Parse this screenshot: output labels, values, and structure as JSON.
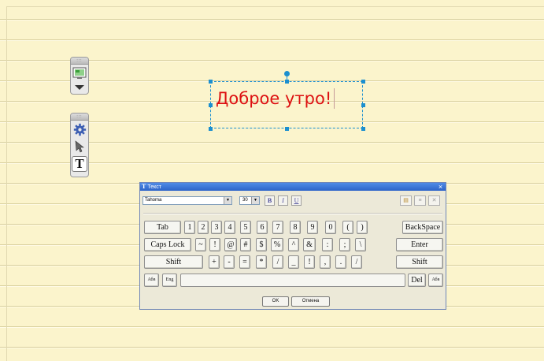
{
  "canvas": {
    "text": "Доброе утро!",
    "text_color": "#dd1111",
    "selection_color": "#1b8fcf",
    "paper_color": "#fbf4cc"
  },
  "panel_top": {
    "tools": [
      {
        "icon": "monitor-image-icon"
      },
      {
        "icon": "chevron-down-icon"
      }
    ]
  },
  "panel_bottom": {
    "tools": [
      {
        "icon": "gear-icon"
      },
      {
        "icon": "pointer-arrow-icon"
      },
      {
        "icon": "text-tool-icon",
        "label": "T"
      }
    ]
  },
  "dialog": {
    "title": "Текст",
    "title_icon": "T",
    "close_glyph": "×",
    "font_name": "Tahoma",
    "font_size": "30",
    "format_buttons": {
      "bold": "B",
      "italic": "I",
      "underline": "U"
    },
    "right_tools": [
      {
        "icon": "paste-icon"
      },
      {
        "icon": "align-icon"
      },
      {
        "icon": "clear-icon"
      }
    ],
    "keyboard": {
      "row1": [
        "Tab",
        "1",
        "2",
        "3",
        "4",
        "5",
        "6",
        "7",
        "8",
        "9",
        "0",
        "(",
        ")",
        "BackSpace"
      ],
      "row2": [
        "Caps Lock",
        "~",
        "!",
        "@",
        "#",
        "$",
        "%",
        "^",
        "&",
        ":",
        ";",
        "\\",
        "Enter"
      ],
      "row3": [
        "Shift",
        "+",
        "-",
        "=",
        "*",
        "/",
        "_",
        "!",
        ",",
        ".",
        "/",
        "Shift"
      ],
      "row4": [
        "Абв",
        "Eng",
        "",
        "Del",
        "Абв"
      ]
    },
    "ok_label": "OK",
    "cancel_label": "Отмена",
    "accent": "#2d64c8"
  }
}
